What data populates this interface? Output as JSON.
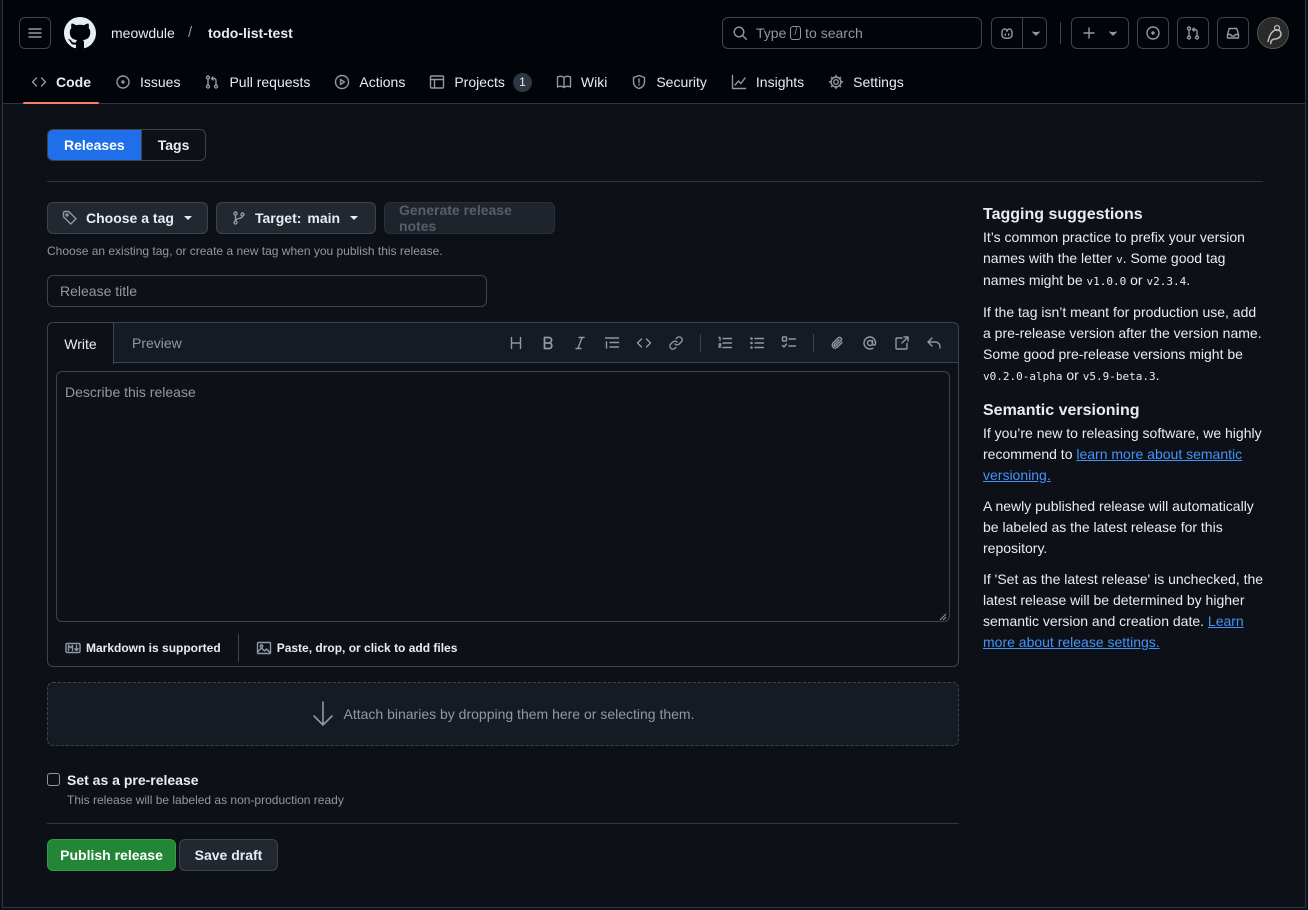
{
  "header": {
    "owner": "meowdule",
    "separator": "/",
    "repo": "todo-list-test",
    "search_before": "Type",
    "search_key": "/",
    "search_after": "to search"
  },
  "nav": {
    "code": "Code",
    "issues": "Issues",
    "pull_requests": "Pull requests",
    "actions": "Actions",
    "projects": "Projects",
    "projects_count": "1",
    "wiki": "Wiki",
    "security": "Security",
    "insights": "Insights",
    "settings": "Settings"
  },
  "subnav": {
    "releases": "Releases",
    "tags": "Tags"
  },
  "form": {
    "choose_tag": "Choose a tag",
    "target_label": "Target:",
    "target_branch": "main",
    "generate_notes": "Generate release notes",
    "tag_hint": "Choose an existing tag, or create a new tag when you publish this release.",
    "title_placeholder": "Release title",
    "tab_write": "Write",
    "tab_preview": "Preview",
    "body_placeholder": "Describe this release",
    "markdown_supported": "Markdown is supported",
    "attach_hint": "Paste, drop, or click to add files",
    "binaries_hint": "Attach binaries by dropping them here or selecting them.",
    "prerelease_label": "Set as a pre-release",
    "prerelease_note": "This release will be labeled as non-production ready",
    "publish": "Publish release",
    "save_draft": "Save draft"
  },
  "sidebar": {
    "tagging_title": "Tagging suggestions",
    "tagging_p1_a": "It’s common practice to prefix your version names with the letter ",
    "tagging_p1_v": "v",
    "tagging_p1_b": ". Some good tag names might be ",
    "tagging_p1_c1": "v1.0.0",
    "tagging_p1_or": " or ",
    "tagging_p1_c2": "v2.3.4",
    "tagging_p1_end": ".",
    "tagging_p2_a": "If the tag isn’t meant for production use, add a pre-release version after the version name. Some good pre-release versions might be ",
    "tagging_p2_c1": "v0.2.0-alpha",
    "tagging_p2_or": " or ",
    "tagging_p2_c2": "v5.9-beta.3",
    "tagging_p2_end": ".",
    "semver_title": "Semantic versioning",
    "semver_p1_a": "If you’re new to releasing software, we highly recommend to ",
    "semver_p1_link": "learn more about semantic versioning.",
    "semver_p2": "A newly published release will automatically be labeled as the latest release for this repository.",
    "semver_p3_a": "If 'Set as the latest release' is unchecked, the latest release will be determined by higher semantic version and creation date. ",
    "semver_p3_link": "Learn more about release settings."
  },
  "colors": {
    "background": "#0d1117",
    "header": "#010409",
    "accent": "#1f6feb",
    "primary_button": "#238636",
    "link": "#4493f8",
    "active_tab_underline": "#f78166"
  }
}
